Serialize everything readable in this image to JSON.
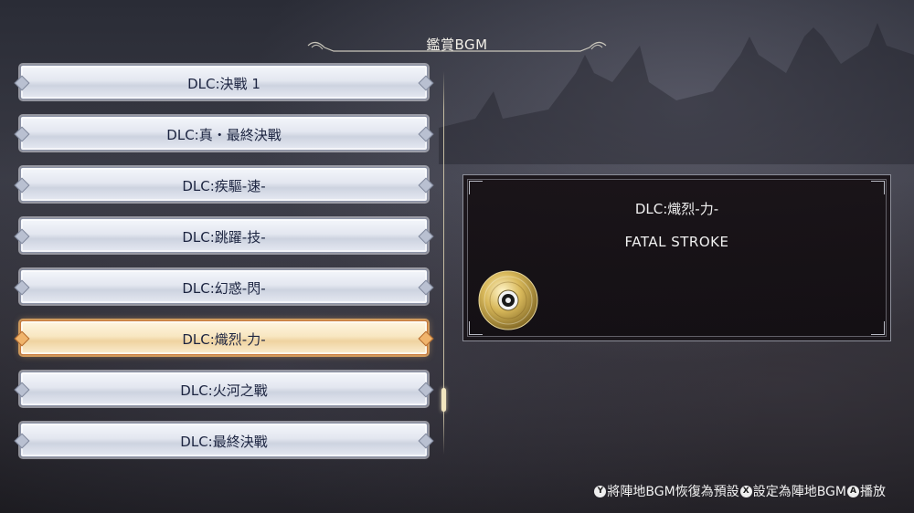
{
  "header": {
    "title": "鑑賞BGM"
  },
  "bgm_list": [
    {
      "label": "DLC:決戰 1",
      "selected": false
    },
    {
      "label": "DLC:真・最終決戰",
      "selected": false
    },
    {
      "label": "DLC:疾驅-速-",
      "selected": false
    },
    {
      "label": "DLC:跳躍-技-",
      "selected": false
    },
    {
      "label": "DLC:幻惑-閃-",
      "selected": false
    },
    {
      "label": "DLC:熾烈-力-",
      "selected": true
    },
    {
      "label": "DLC:火河之戰",
      "selected": false
    },
    {
      "label": "DLC:最終決戰",
      "selected": false
    }
  ],
  "scrollbar": {
    "position_fraction": 0.88
  },
  "detail": {
    "title": "DLC:熾烈-力-",
    "subtitle": "FATAL STROKE",
    "disc_icon": "cd-disc-icon"
  },
  "footer": {
    "hints": [
      {
        "button": "Y",
        "label": "將陣地BGM恢復為預設"
      },
      {
        "button": "X",
        "label": "設定為陣地BGM"
      },
      {
        "button": "A",
        "label": "播放"
      }
    ]
  },
  "colors": {
    "item_bg": "#e3e7f0",
    "item_text": "#1c2440",
    "selected_bg": "#f8e7c2",
    "selected_glow": "#f4b163",
    "panel_bg": "#161014",
    "text_light": "#f1f1f1"
  }
}
